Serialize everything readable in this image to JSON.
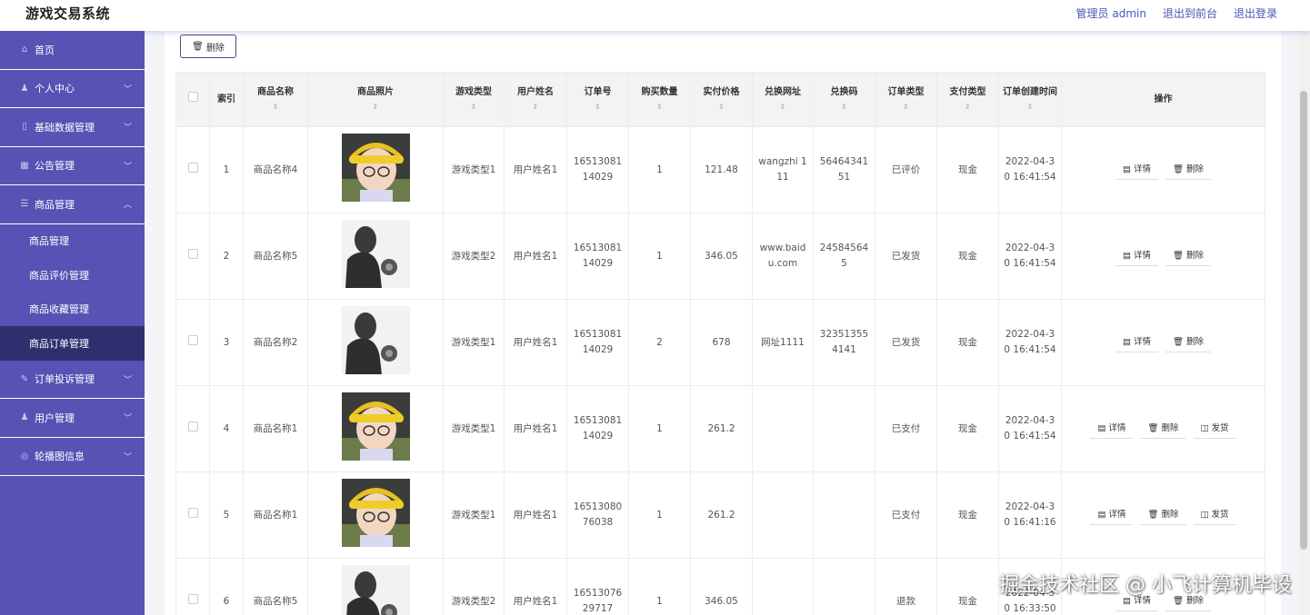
{
  "header": {
    "title": "游戏交易系统",
    "links": [
      "管理员 admin",
      "退出到前台",
      "退出登录"
    ]
  },
  "sidebar": {
    "items": [
      {
        "label": "首页",
        "icon": "home-icon",
        "glyph": "⌂",
        "chevron": ""
      },
      {
        "label": "个人中心",
        "icon": "user-icon",
        "glyph": "♟",
        "chevron": "﹀"
      },
      {
        "label": "基础数据管理",
        "icon": "phone-icon",
        "glyph": "▯",
        "chevron": "﹀"
      },
      {
        "label": "公告管理",
        "icon": "grid-icon",
        "glyph": "▦",
        "chevron": "﹀"
      },
      {
        "label": "商品管理",
        "icon": "list-icon",
        "glyph": "☰",
        "chevron": "︿"
      }
    ],
    "sub_items": [
      "商品管理",
      "商品评价管理",
      "商品收藏管理",
      "商品订单管理"
    ],
    "active_sub": 3,
    "items_after": [
      {
        "label": "订单投诉管理",
        "icon": "thumb-icon",
        "glyph": "✎",
        "chevron": "﹀"
      },
      {
        "label": "用户管理",
        "icon": "user-icon",
        "glyph": "♟",
        "chevron": "﹀"
      },
      {
        "label": "轮播图信息",
        "icon": "settings-icon",
        "glyph": "◎",
        "chevron": "﹀"
      }
    ]
  },
  "toolbar": {
    "delete_label": "删除"
  },
  "table": {
    "headers": [
      "索引",
      "商品名称",
      "商品照片",
      "游戏类型",
      "用户姓名",
      "订单号",
      "购买数量",
      "实付价格",
      "兑换网址",
      "兑换码",
      "订单类型",
      "支付类型",
      "订单创建时间",
      "操作"
    ],
    "op_labels": {
      "detail": "详情",
      "delete": "删除",
      "ship": "发货"
    },
    "rows": [
      {
        "index": "1",
        "name": "商品名称4",
        "photo": "cartoon",
        "game_type": "游戏类型1",
        "user": "用户姓名1",
        "order_no": "1651308114029",
        "qty": "1",
        "price": "121.48",
        "url": "wangzhi 111",
        "code": "5646434151",
        "order_type": "已评价",
        "pay_type": "现金",
        "created": "2022-04-30 16:41:54",
        "ship": false
      },
      {
        "index": "2",
        "name": "商品名称5",
        "photo": "silhouette",
        "game_type": "游戏类型2",
        "user": "用户姓名1",
        "order_no": "1651308114029",
        "qty": "1",
        "price": "346.05",
        "url": "www.baidu.com",
        "code": "245845645",
        "order_type": "已发货",
        "pay_type": "现金",
        "created": "2022-04-30 16:41:54",
        "ship": false
      },
      {
        "index": "3",
        "name": "商品名称2",
        "photo": "silhouette",
        "game_type": "游戏类型1",
        "user": "用户姓名1",
        "order_no": "1651308114029",
        "qty": "2",
        "price": "678",
        "url": "网址1111",
        "code": "323513554141",
        "order_type": "已发货",
        "pay_type": "现金",
        "created": "2022-04-30 16:41:54",
        "ship": false
      },
      {
        "index": "4",
        "name": "商品名称1",
        "photo": "cartoon",
        "game_type": "游戏类型1",
        "user": "用户姓名1",
        "order_no": "1651308114029",
        "qty": "1",
        "price": "261.2",
        "url": "",
        "code": "",
        "order_type": "已支付",
        "pay_type": "现金",
        "created": "2022-04-30 16:41:54",
        "ship": true
      },
      {
        "index": "5",
        "name": "商品名称1",
        "photo": "cartoon",
        "game_type": "游戏类型1",
        "user": "用户姓名1",
        "order_no": "1651308076038",
        "qty": "1",
        "price": "261.2",
        "url": "",
        "code": "",
        "order_type": "已支付",
        "pay_type": "现金",
        "created": "2022-04-30 16:41:16",
        "ship": true
      },
      {
        "index": "6",
        "name": "商品名称5",
        "photo": "silhouette",
        "game_type": "游戏类型2",
        "user": "用户姓名1",
        "order_no": "1651307629717",
        "qty": "1",
        "price": "346.05",
        "url": "",
        "code": "",
        "order_type": "退款",
        "pay_type": "现金",
        "created": "2022-04-30 16:33:50",
        "ship": false
      }
    ]
  },
  "watermark": "掘金技术社区 @ 小飞计算机毕设"
}
